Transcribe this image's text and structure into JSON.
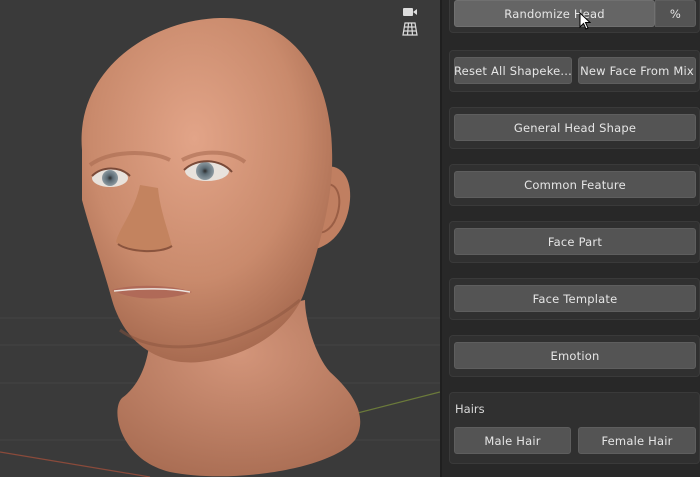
{
  "panel": {
    "randomize_head": "Randomize Head",
    "percent_label": "%",
    "reset_shapekeys": "Reset All Shapeke...",
    "new_face_from_mix": "New Face From Mix",
    "general_head_shape": "General Head Shape",
    "common_feature": "Common Feature",
    "face_part": "Face Part",
    "face_template": "Face Template",
    "emotion": "Emotion",
    "hairs": {
      "title": "Hairs",
      "male": "Male Hair",
      "female": "Female Hair"
    }
  },
  "viewport": {
    "tools": [
      "camera-icon",
      "grid-icon"
    ]
  },
  "colors": {
    "viewport_bg": "#3a3a3a",
    "panel_bg": "#282828",
    "button_bg": "#545454",
    "skin": "#c98a6c"
  }
}
